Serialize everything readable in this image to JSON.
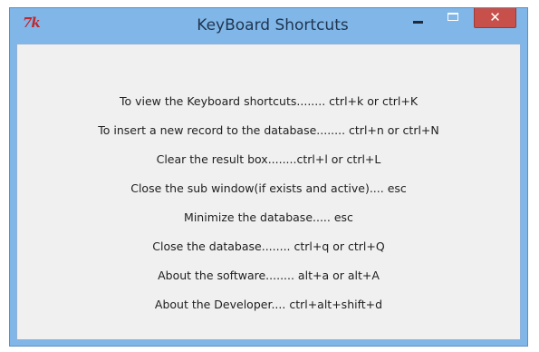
{
  "window": {
    "title": "KeyBoard Shortcuts",
    "app_icon_text": "7k",
    "close_glyph": "✕"
  },
  "shortcuts": [
    "To view the Keyboard shortcuts........ ctrl+k or ctrl+K",
    "To insert a new record to the database........ ctrl+n or ctrl+N",
    "Clear the result box........ctrl+l or ctrl+L",
    "Close the sub window(if exists and active).... esc",
    "Minimize the database..... esc",
    "Close the database........ ctrl+q or ctrl+Q",
    "About the software........ alt+a or alt+A",
    "About the Developer.... ctrl+alt+shift+d"
  ],
  "colors": {
    "frame": "#80b7e8",
    "client": "#f0f0f0",
    "close": "#c7504b",
    "app_icon": "#c1272d"
  },
  "icons": {
    "app": "tk-feather-icon",
    "minimize": "minimize-icon",
    "maximize": "maximize-icon",
    "close": "close-icon"
  }
}
